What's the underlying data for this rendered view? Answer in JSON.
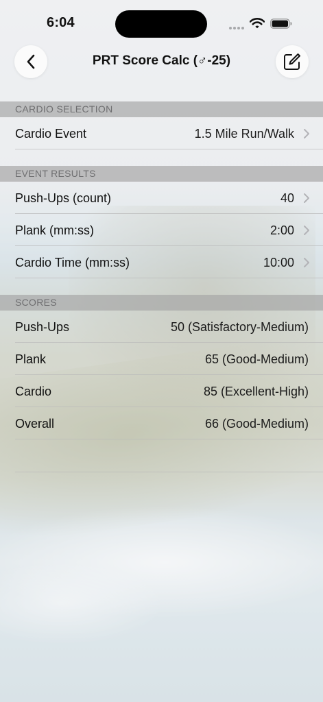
{
  "status_bar": {
    "time": "6:04"
  },
  "nav": {
    "title": "PRT Score Calc (♂-25)",
    "back_icon": "chevron-left-icon",
    "edit_icon": "compose-icon"
  },
  "sections": {
    "cardio_selection": {
      "header": "CARDIO SELECTION",
      "cardio_event": {
        "label": "Cardio Event",
        "value": "1.5 Mile Run/Walk"
      }
    },
    "event_results": {
      "header": "EVENT RESULTS",
      "pushups": {
        "label": "Push-Ups (count)",
        "value": "40"
      },
      "plank": {
        "label": "Plank (mm:ss)",
        "value": "2:00"
      },
      "cardio_time": {
        "label": "Cardio Time (mm:ss)",
        "value": "10:00"
      }
    },
    "scores": {
      "header": "SCORES",
      "pushups": {
        "label": "Push-Ups",
        "value": "50 (Satisfactory-Medium)"
      },
      "plank": {
        "label": "Plank",
        "value": "65 (Good-Medium)"
      },
      "cardio": {
        "label": "Cardio",
        "value": "85 (Excellent-High)"
      },
      "overall": {
        "label": "Overall",
        "value": "66 (Good-Medium)"
      }
    }
  },
  "colors": {
    "section_header_text": "#6e6e70",
    "chevron": "#b3b3b7",
    "button_background": "#fbfbfb"
  }
}
